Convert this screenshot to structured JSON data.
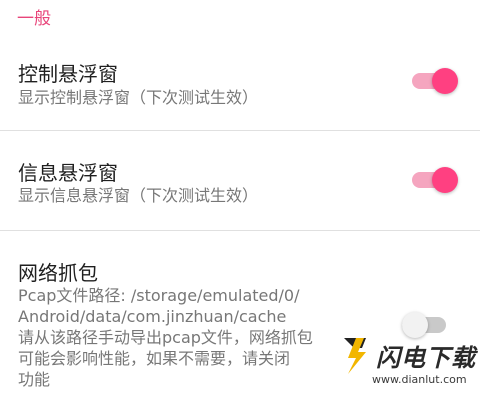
{
  "section": {
    "title": "一般"
  },
  "settings": [
    {
      "title": "控制悬浮窗",
      "summary": [
        "显示控制悬浮窗（下次测试生效）"
      ],
      "enabled": true
    },
    {
      "title": "信息悬浮窗",
      "summary": [
        "显示信息悬浮窗（下次测试生效）"
      ],
      "enabled": true
    },
    {
      "title": "网络抓包",
      "summary": [
        "Pcap文件路径: /storage/emulated/0/",
        "Android/data/com.jinzhuan/cache",
        "请从该路径手动导出pcap文件，网络抓包",
        "可能会影响性能，如果不需要，请关闭",
        "功能"
      ],
      "enabled": false
    }
  ],
  "watermark": {
    "name": "闪电下载",
    "url": "www.dianlut.com"
  },
  "colors": {
    "accent": "#ff4081",
    "accent_track": "#f5a5bf",
    "section_header": "#e8457a"
  },
  "icons": {
    "watermark_logo": "lightning-logo-icon"
  }
}
